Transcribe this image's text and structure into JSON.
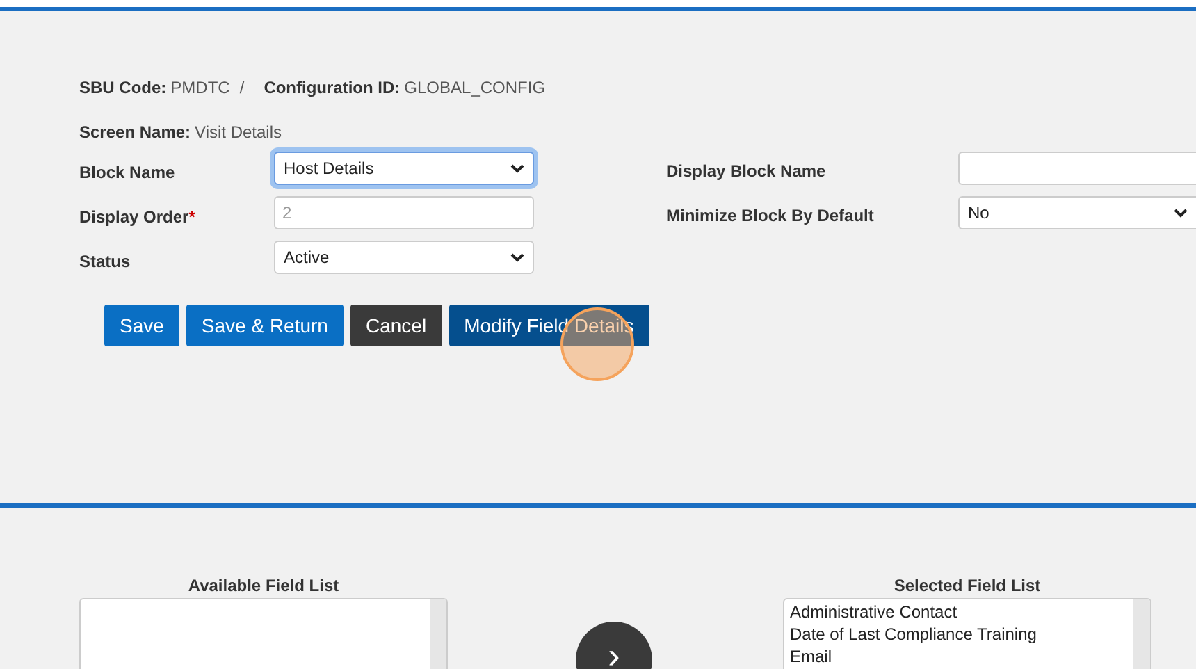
{
  "header": {
    "sbu_label": "SBU Code:",
    "sbu_value": "PMDTC",
    "separator": "/",
    "config_label": "Configuration ID:",
    "config_value": "GLOBAL_CONFIG",
    "screen_label": "Screen Name:",
    "screen_value": "Visit Details"
  },
  "left_fields": [
    {
      "label": "Block Name",
      "kind": "select",
      "value": "Host Details",
      "focused": true
    },
    {
      "label": "Display Order",
      "required_mark": "*",
      "kind": "input",
      "placeholder": "2",
      "focused": false
    },
    {
      "label": "Status",
      "kind": "select",
      "value": "Active",
      "focused": false
    }
  ],
  "right_fields": [
    {
      "label": "Display Block Name",
      "kind": "input"
    },
    {
      "label": "Minimize Block By Default",
      "kind": "select",
      "value": "No"
    }
  ],
  "buttons": [
    {
      "label": "Save",
      "kind": "primary"
    },
    {
      "label": "Save & Return",
      "kind": "primary"
    },
    {
      "label": "Cancel",
      "kind": "dark"
    },
    {
      "label": "Modify Field Details",
      "kind": "accent"
    }
  ],
  "available_list": {
    "title": "Available Field List"
  },
  "move_button": {
    "label": "›"
  },
  "selected_list": {
    "title": "Selected Field List",
    "items": [
      "Administrative Contact",
      "Date of Last Compliance Training",
      "Email"
    ]
  }
}
